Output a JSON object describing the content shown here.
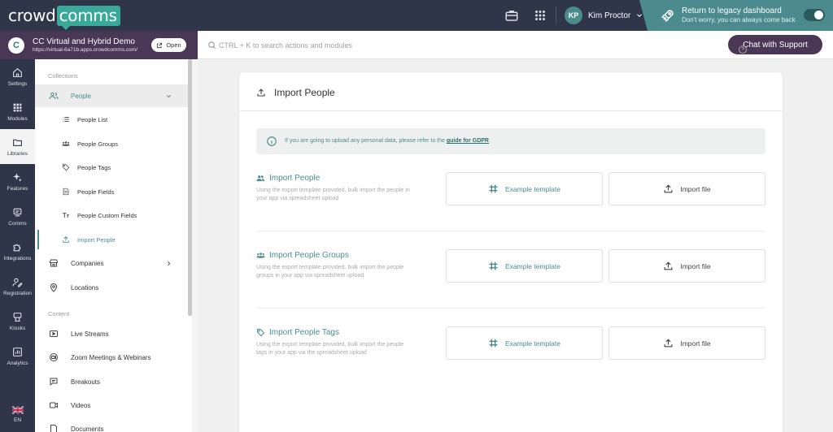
{
  "topbar": {
    "logo_part1": "crowd",
    "logo_part2": "comms",
    "user_initials": "KP",
    "user_name": "Kim Proctor",
    "legacy_title": "Return to legacy dashboard",
    "legacy_subtitle": "Don't worry, you can always come back"
  },
  "app": {
    "name": "CC Virtual and Hybrid Demo",
    "url": "https://virtual-6a71b.apps.crowdcomms.com/",
    "open_label": "Open"
  },
  "search": {
    "placeholder": "CTRL + K to search actions and modules"
  },
  "support": {
    "label": "Chat with Support"
  },
  "rail": [
    {
      "label": "Settings",
      "icon": "home-icon"
    },
    {
      "label": "Modules",
      "icon": "grid-icon"
    },
    {
      "label": "Libraries",
      "icon": "folder-icon",
      "active": true
    },
    {
      "label": "Features",
      "icon": "sparkle-icon"
    },
    {
      "label": "Comms",
      "icon": "comms-icon"
    },
    {
      "label": "Integrations",
      "icon": "puzzle-icon"
    },
    {
      "label": "Registration",
      "icon": "user-edit-icon"
    },
    {
      "label": "Kiosks",
      "icon": "kiosk-icon"
    },
    {
      "label": "Analytics",
      "icon": "chart-icon"
    },
    {
      "label": "EN",
      "icon": "uk-flag-icon"
    }
  ],
  "sidebar": {
    "collections_heading": "Collections",
    "people": "People",
    "people_sub": [
      "People List",
      "People Groups",
      "People Tags",
      "People Fields",
      "People Custom Fields",
      "Import People"
    ],
    "companies": "Companies",
    "locations": "Locations",
    "content_heading": "Content",
    "content_items": [
      "Live Streams",
      "Zoom Meetings & Webinars",
      "Breakouts",
      "Videos",
      "Documents"
    ]
  },
  "main": {
    "title": "Import People",
    "notice_text": "If you are going to upload any personal data, please refer to the ",
    "notice_link": "guide for GDPR",
    "sections": [
      {
        "title": "Import People",
        "desc": "Using the export template provided, bulk import the people in your app via spreadsheet upload",
        "template_label": "Example template",
        "import_label": "Import file"
      },
      {
        "title": "Import People Groups",
        "desc": "Using the export template provided, bulk import the people groups in your app via spreadsheet upload",
        "template_label": "Example template",
        "import_label": "Import file"
      },
      {
        "title": "Import People Tags",
        "desc": "Using the export template provided, bulk import the people tags in your app via the spreadsheet upload",
        "template_label": "Example template",
        "import_label": "Import file"
      }
    ]
  },
  "colors": {
    "accent": "#4b8b8e",
    "navy": "#2f3649",
    "purple": "#4a3755"
  }
}
